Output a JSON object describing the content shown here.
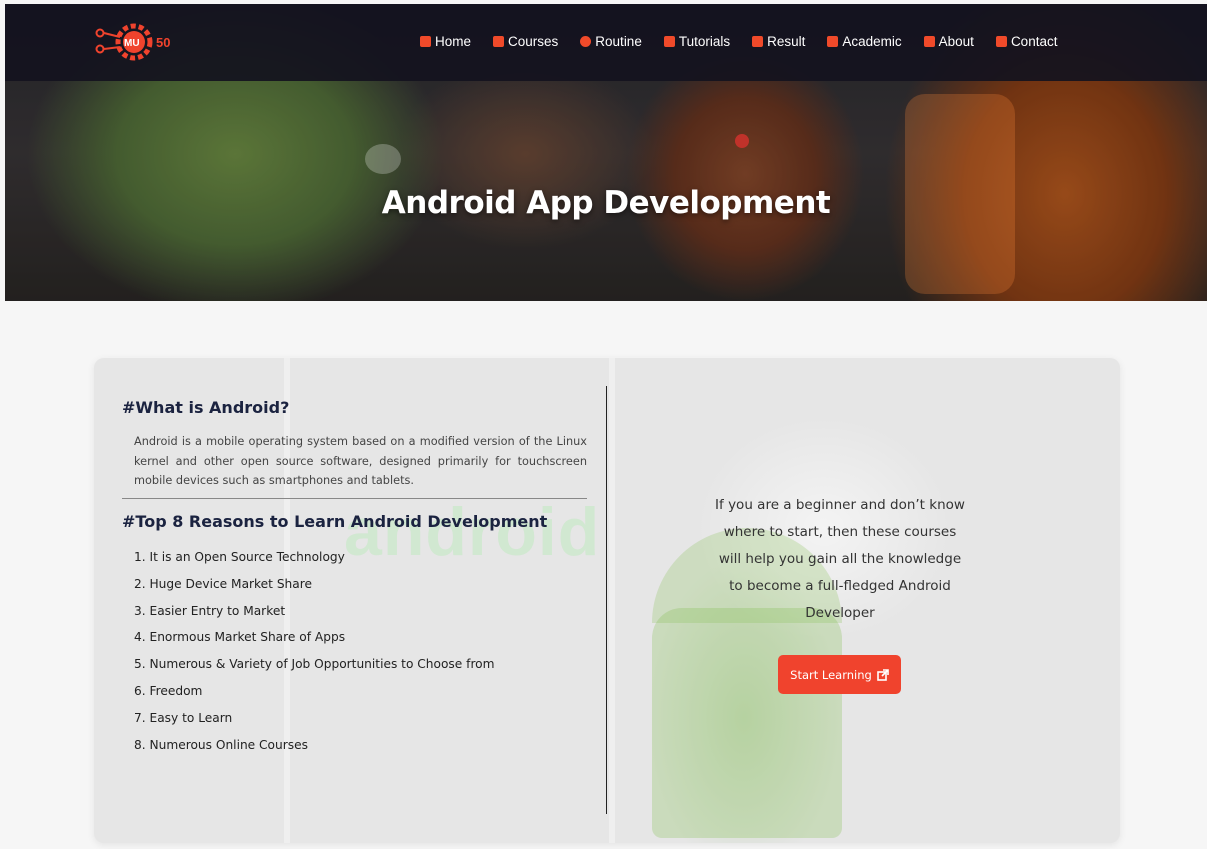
{
  "nav": {
    "logo_text": "MU CSE 50",
    "items": [
      {
        "label": "Home",
        "icon": "home-icon"
      },
      {
        "label": "Courses",
        "icon": "book-icon"
      },
      {
        "label": "Routine",
        "icon": "clock-icon"
      },
      {
        "label": "Tutorials",
        "icon": "chalkboard-icon"
      },
      {
        "label": "Result",
        "icon": "chart-icon"
      },
      {
        "label": "Academic",
        "icon": "university-icon"
      },
      {
        "label": "About",
        "icon": "id-card-icon"
      },
      {
        "label": "Contact",
        "icon": "address-book-icon"
      }
    ]
  },
  "hero": {
    "title": "Android App Development"
  },
  "card": {
    "watermark": "android",
    "what_heading": "#What is Android?",
    "what_text": "Android is a mobile operating system based on a modified version of the Linux kernel and other open source software, designed primarily for touchscreen mobile devices such as smartphones and tablets.",
    "reasons_heading": "#Top 8 Reasons to Learn Android Development",
    "reasons": [
      "1. It is an Open Source Technology",
      "2. Huge Device Market Share",
      "3. Easier Entry to Market",
      "4. Enormous Market Share of Apps",
      "5. Numerous & Variety of Job Opportunities to Choose from",
      "6. Freedom",
      "7. Easy to Learn",
      "8. Numerous Online Courses"
    ],
    "cta_text": "If you are a beginner and don’t know where to start, then these courses will help you gain all the knowledge to become a full-fledged Android Developer",
    "cta_button": "Start Learning"
  },
  "colors": {
    "accent": "#f0432d",
    "navbar": "#14121e",
    "heading": "#1b2340"
  }
}
